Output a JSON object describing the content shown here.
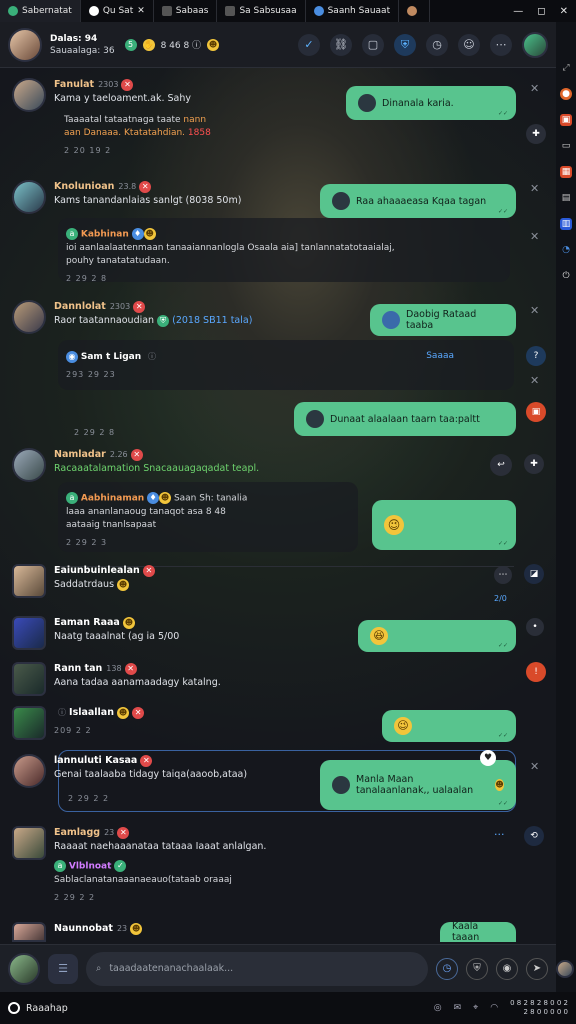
{
  "tabs": [
    {
      "label": "Sabernatat",
      "color": "#3ab07a"
    },
    {
      "label": "Qu  Sat",
      "color": "#ffffff"
    },
    {
      "label": "Sabaas",
      "color": "#777777"
    },
    {
      "label": "Sa Sabsusaa",
      "color": "#777777"
    },
    {
      "label": "Saanh Sauaat",
      "color": "#4a8de0"
    },
    {
      "label": "",
      "color": "#c08a60"
    }
  ],
  "window_controls": {
    "minimize": "—",
    "maximize": "◻",
    "close": "✕"
  },
  "header": {
    "title": "Dalas: 94",
    "subtitle": "Sauaalaga: 36",
    "meta": "8 46 8 ⓘ"
  },
  "messages": [
    {
      "name": "Fanulat",
      "time": "2303",
      "body": "Kama y taeloament.ak. Sahy",
      "quote_a": "Taaaatal tataatnaga taate",
      "quote_hi": "nann",
      "quote_b": "aan Danaaa. Ktatatahdian.",
      "quote_red": "1858",
      "meta": "2 20  19 2"
    },
    {
      "name": "Knolunioan",
      "time": "23.8",
      "body": "Kams tanandanlaias sanlgt (8038 50m)",
      "quote_name": "Kabhinan",
      "quote_body": "ioi aanlaalaatenmaan tanaaiannanlogla Osaala aia] tanlannatatotaaialaj,",
      "quote_b": "pouhy tanatatatudaan.",
      "meta": "2 29 2 8"
    },
    {
      "name": "Dannlolat",
      "time": "2303",
      "body": "Raor taatannaoudian",
      "body_b": "(2018 SB11 tala)",
      "quote_name": "Sam t Ligan",
      "quote_tag": "Saaaa",
      "meta": "293 29 23"
    },
    {
      "name": "Namladar",
      "time": "2.26",
      "body": "Racaaatalamation Snacaauagaqadat teapl.",
      "quote_name": "Aabhinaman",
      "quote_extra": "Saan Sh: tanalia",
      "quote_a": "laaa ananlanaoug tanaqot asa 8 48",
      "quote_b": "aataaig tnanlsapaat",
      "meta": "2 29 2 3"
    },
    {
      "name": "Eaiunbuinlealan",
      "time": "",
      "body": "Saddatrdaus",
      "meta": ""
    },
    {
      "name": "Eaman Raaa",
      "time": "",
      "body": "Naatg taaalnat (ag ia 5/00",
      "meta": ""
    },
    {
      "name": "Rann tan",
      "time": "138",
      "body": "Aana tadaa aanamaadagy katalng.",
      "meta": ""
    },
    {
      "name": "Islaallan",
      "time": "",
      "body": "",
      "meta": "209 2 2"
    },
    {
      "name": "lannuluti Kasaa",
      "time": "",
      "body": "Genai taalaaba tidagy taiqa(aaoob,ataa)",
      "meta": "2 29 2 2"
    },
    {
      "name": "Eamlagg",
      "time": "23",
      "body": "Raaaat naehaaanataa tataaa Iaaat anlalgan.",
      "quote_name": "Vlblnoat",
      "quote_body": "Sablaclanatanaaanaeauo(tataab oraaaj",
      "meta": "2 29 2 2"
    },
    {
      "name": "Naunnobat",
      "time": "23",
      "body": "",
      "meta": ""
    }
  ],
  "bubbles": [
    {
      "text": "Dinanala karia.",
      "ticks": "✓✓"
    },
    {
      "text": "Raa ahaaaeasa Kqaa tagan",
      "ticks": "✓✓"
    },
    {
      "text": "Daobig Rataad taaba",
      "ticks": ""
    },
    {
      "text": "Dunaat alaalaan taarn taa:paltt",
      "ticks": ""
    },
    {
      "text": "",
      "ticks": "✓✓"
    },
    {
      "text": "",
      "ticks": "✓✓"
    },
    {
      "text": "",
      "ticks": "✓✓"
    },
    {
      "text": "Manla Maan tanalaanlanak,, ualaalan",
      "ticks": "✓✓"
    },
    {
      "text": "Kaala taaan",
      "ticks": ""
    }
  ],
  "side_labels": {
    "seen": "2/0",
    "tag": "Saaaa"
  },
  "composer": {
    "placeholder": "taaadaatenanachaalaak..."
  },
  "statusbar": {
    "app": "Raaahap",
    "clock_a": "0 8 2 8 2 8 0 0 2",
    "clock_b": "2 8 0 0 0 0 0"
  },
  "colors": {
    "accent": "#58c48e",
    "bg": "#15171d",
    "link": "#5db3ff"
  }
}
